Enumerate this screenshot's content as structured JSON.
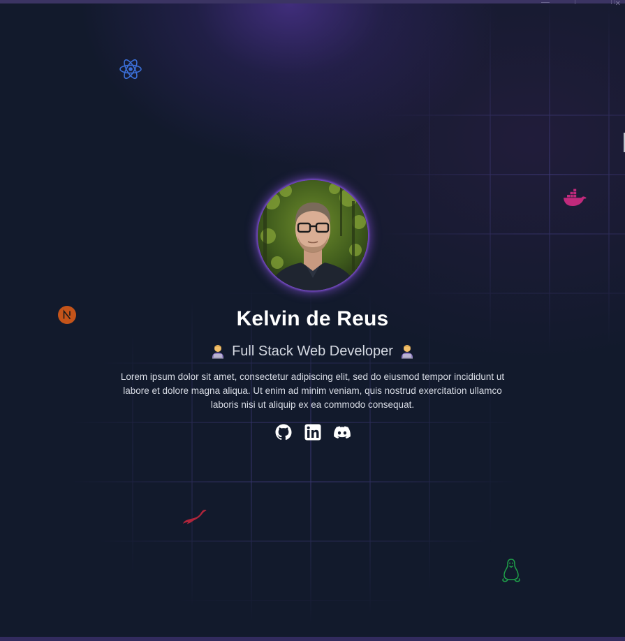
{
  "profile": {
    "name": "Kelvin de Reus",
    "role": "Full Stack Web Developer",
    "bio": "Lorem ipsum dolor sit amet, consectetur adipiscing elit, sed do eiusmod tempor incididunt ut labore et dolore magna aliqua. Ut enim ad minim veniam, quis nostrud exercitation ullamco laboris nisi ut aliquip ex ea commodo consequat."
  },
  "socials": [
    {
      "icon": "github-icon"
    },
    {
      "icon": "linkedin-icon"
    },
    {
      "icon": "discord-icon"
    }
  ],
  "floating_icons": [
    {
      "icon": "react-icon",
      "color": "#3b6fd8"
    },
    {
      "icon": "docker-icon",
      "color": "#c02a7c"
    },
    {
      "icon": "nextjs-icon",
      "color": "#c4541a"
    },
    {
      "icon": "mariadb-icon",
      "color": "#b0253b"
    },
    {
      "icon": "linux-icon",
      "color": "#1fa34a"
    }
  ],
  "colors": {
    "background": "#121a2c",
    "glow": "#503496",
    "accent": "#9a5cf0"
  }
}
